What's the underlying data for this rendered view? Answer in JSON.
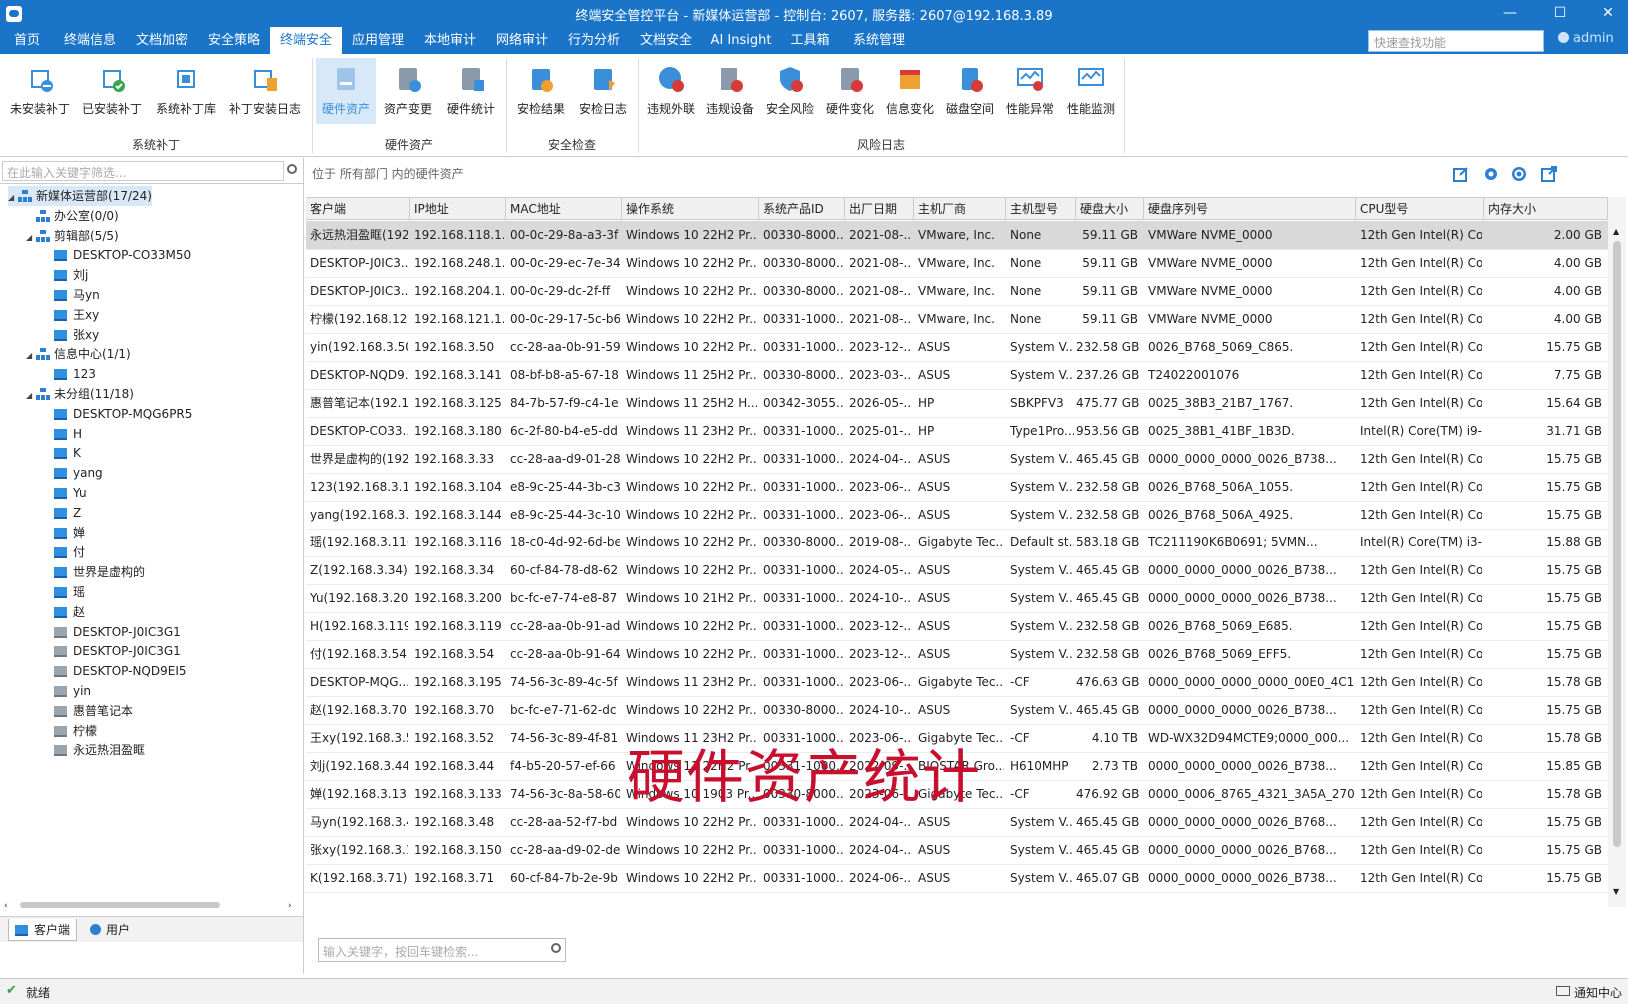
{
  "window": {
    "title": "终端安全管控平台 - 新媒体运营部 - 控制台: 2607, 服务器: 2607@192.168.3.89"
  },
  "menu": [
    "首页",
    "终端信息",
    "文档加密",
    "安全策略",
    "终端安全",
    "应用管理",
    "本地审计",
    "网络审计",
    "行为分析",
    "文档安全",
    "AI Insight",
    "工具箱",
    "系统管理"
  ],
  "quick_search": {
    "placeholder": "快速查找功能"
  },
  "user": {
    "name": "admin"
  },
  "ribbon": {
    "buttons": [
      "未安装补丁",
      "已安装补丁",
      "系统补丁库",
      "补丁安装日志",
      "硬件资产",
      "资产变更",
      "硬件统计",
      "安检结果",
      "安检日志",
      "违规外联",
      "违规设备",
      "安全风险",
      "硬件变化",
      "信息变化",
      "磁盘空间",
      "性能异常",
      "性能监测"
    ],
    "groups": [
      "系统补丁",
      "硬件资产",
      "安全检查",
      "风险日志"
    ]
  },
  "left": {
    "filter_placeholder": "在此输入关键字筛选...",
    "tree": [
      "新媒体运营部(17/24)",
      "办公室(0/0)",
      "剪辑部(5/5)",
      "DESKTOP-CO33M50",
      "刘j",
      "马yn",
      "王xy",
      "张xy",
      "信息中心(1/1)",
      "123",
      "未分组(11/18)",
      "DESKTOP-MQG6PR5",
      "H",
      "K",
      "yang",
      "Yu",
      "Z",
      "婵",
      "付",
      "世界是虚构的",
      "瑶",
      "赵",
      "DESKTOP-J0IC3G1",
      "DESKTOP-J0IC3G1",
      "DESKTOP-NQD9EI5",
      "yin",
      "惠普笔记本",
      "柠檬",
      "永远热泪盈眶"
    ],
    "tabs": [
      "客户端",
      "用户"
    ]
  },
  "main": {
    "breadcrumb": "位于 所有部门 内的硬件资产",
    "columns": [
      "客户端",
      "IP地址",
      "MAC地址",
      "操作系统",
      "系统产品ID",
      "出厂日期",
      "主机厂商",
      "主机型号",
      "硬盘大小",
      "硬盘序列号",
      "CPU型号",
      "内存大小"
    ],
    "rows": [
      [
        "永远热泪盈眶(192...",
        "192.168.118.1...",
        "00-0c-29-8a-a3-3f",
        "Windows 10 22H2 Pr...",
        "00330-8000...",
        "2021-08-...",
        "VMware, Inc.",
        "None",
        "59.11 GB",
        "VMWare NVME_0000",
        "12th Gen Intel(R) Co...",
        "2.00 GB"
      ],
      [
        "DESKTOP-J0IC3...",
        "192.168.248.1...",
        "00-0c-29-ec-7e-34",
        "Windows 10 22H2 Pr...",
        "00330-8000...",
        "2021-08-...",
        "VMware, Inc.",
        "None",
        "59.11 GB",
        "VMWare NVME_0000",
        "12th Gen Intel(R) Co...",
        "4.00 GB"
      ],
      [
        "DESKTOP-J0IC3...",
        "192.168.204.1...",
        "00-0c-29-dc-2f-ff",
        "Windows 10 22H2 Pr...",
        "00330-8000...",
        "2021-08-...",
        "VMware, Inc.",
        "None",
        "59.11 GB",
        "VMWare NVME_0000",
        "12th Gen Intel(R) Co...",
        "4.00 GB"
      ],
      [
        "柠檬(192.168.121...",
        "192.168.121.1...",
        "00-0c-29-17-5c-b6",
        "Windows 10 22H2 Pr...",
        "00331-1000...",
        "2021-08-...",
        "VMware, Inc.",
        "None",
        "59.11 GB",
        "VMWare NVME_0000",
        "12th Gen Intel(R) Co...",
        "4.00 GB"
      ],
      [
        "yin(192.168.3.50)",
        "192.168.3.50",
        "cc-28-aa-0b-91-59",
        "Windows 10 22H2 Pr...",
        "00331-1000...",
        "2023-12-...",
        "ASUS",
        "System V...",
        "232.58 GB",
        "0026_B768_5069_C865.",
        "12th Gen Intel(R) Co...",
        "15.75 GB"
      ],
      [
        "DESKTOP-NQD9...",
        "192.168.3.141",
        "08-bf-b8-a5-67-18",
        "Windows 11 25H2 Pr...",
        "00330-8000...",
        "2023-03-...",
        "ASUS",
        "System V...",
        "237.26 GB",
        "T24022001076",
        "12th Gen Intel(R) Co...",
        "7.75 GB"
      ],
      [
        "惠普笔记本(192.1...",
        "192.168.3.125",
        "84-7b-57-f9-c4-1e",
        "Windows 11 25H2 H...",
        "00342-3055...",
        "2026-05-...",
        "HP",
        "SBKPFV3",
        "475.77 GB",
        "0025_38B3_21B7_1767.",
        "12th Gen Intel(R) Co...",
        "15.64 GB"
      ],
      [
        "DESKTOP-CO33...",
        "192.168.3.180",
        "6c-2f-80-b4-e5-dd",
        "Windows 11 23H2 Pr...",
        "00331-1000...",
        "2025-01-...",
        "HP",
        "Type1Pro...",
        "953.56 GB",
        "0025_38B1_41BF_1B3D.",
        "Intel(R) Core(TM) i9-...",
        "31.71 GB"
      ],
      [
        "世界是虚构的(192...",
        "192.168.3.33",
        "cc-28-aa-d9-01-28",
        "Windows 10 22H2 Pr...",
        "00331-1000...",
        "2024-04-...",
        "ASUS",
        "System V...",
        "465.45 GB",
        "0000_0000_0000_0026_B738...",
        "12th Gen Intel(R) Co...",
        "15.75 GB"
      ],
      [
        "123(192.168.3.10...",
        "192.168.3.104",
        "e8-9c-25-44-3b-c3",
        "Windows 10 22H2 Pr...",
        "00331-1000...",
        "2023-06-...",
        "ASUS",
        "System V...",
        "232.58 GB",
        "0026_B768_506A_1055.",
        "12th Gen Intel(R) Co...",
        "15.75 GB"
      ],
      [
        "yang(192.168.3.1...",
        "192.168.3.144",
        "e8-9c-25-44-3c-10",
        "Windows 10 22H2 Pr...",
        "00331-1000...",
        "2023-06-...",
        "ASUS",
        "System V...",
        "232.58 GB",
        "0026_B768_506A_4925.",
        "12th Gen Intel(R) Co...",
        "15.75 GB"
      ],
      [
        "瑶(192.168.3.116)",
        "192.168.3.116",
        "18-c0-4d-92-6d-be",
        "Windows 10 22H2 Pr...",
        "00330-8000...",
        "2019-08-...",
        "Gigabyte Tec...",
        "Default st...",
        "583.18 GB",
        "TC211190K6B0691;        5VMN...",
        "Intel(R) Core(TM) i3-...",
        "15.88 GB"
      ],
      [
        "Z(192.168.3.34)",
        "192.168.3.34",
        "60-cf-84-78-d8-62",
        "Windows 10 22H2 Pr...",
        "00331-1000...",
        "2024-05-...",
        "ASUS",
        "System V...",
        "465.45 GB",
        "0000_0000_0000_0026_B738...",
        "12th Gen Intel(R) Co...",
        "15.75 GB"
      ],
      [
        "Yu(192.168.3.200)",
        "192.168.3.200",
        "bc-fc-e7-74-e8-87",
        "Windows 10 21H2 Pr...",
        "00331-1000...",
        "2024-10-...",
        "ASUS",
        "System V...",
        "465.45 GB",
        "0000_0000_0000_0026_B738...",
        "12th Gen Intel(R) Co...",
        "15.75 GB"
      ],
      [
        "H(192.168.3.119)",
        "192.168.3.119",
        "cc-28-aa-0b-91-ad",
        "Windows 10 22H2 Pr...",
        "00331-1000...",
        "2023-12-...",
        "ASUS",
        "System V...",
        "232.58 GB",
        "0026_B768_5069_E685.",
        "12th Gen Intel(R) Co...",
        "15.75 GB"
      ],
      [
        "付(192.168.3.54)",
        "192.168.3.54",
        "cc-28-aa-0b-91-64",
        "Windows 10 22H2 Pr...",
        "00331-1000...",
        "2023-12-...",
        "ASUS",
        "System V...",
        "232.58 GB",
        "0026_B768_5069_EFF5.",
        "12th Gen Intel(R) Co...",
        "15.75 GB"
      ],
      [
        "DESKTOP-MQG...",
        "192.168.3.195",
        "74-56-3c-89-4c-5f",
        "Windows 11 23H2 Pr...",
        "00331-1000...",
        "2023-06-...",
        "Gigabyte Tec...",
        "-CF",
        "476.63 GB",
        "0000_0000_0000_0000_00E0_4C11...",
        "12th Gen Intel(R) Co...",
        "15.78 GB"
      ],
      [
        "赵(192.168.3.70)",
        "192.168.3.70",
        "bc-fc-e7-71-62-dc",
        "Windows 10 22H2 Pr...",
        "00330-8000...",
        "2024-10-...",
        "ASUS",
        "System V...",
        "465.45 GB",
        "0000_0000_0000_0026_B738...",
        "12th Gen Intel(R) Co...",
        "15.75 GB"
      ],
      [
        "王xy(192.168.3.52)",
        "192.168.3.52",
        "74-56-3c-89-4f-81",
        "Windows 11 23H2 Pr...",
        "00331-1000...",
        "2023-06-...",
        "Gigabyte Tec...",
        "-CF",
        "4.10 TB",
        "WD-WX32D94MCTE9;0000_000...",
        "12th Gen Intel(R) Co...",
        "15.78 GB"
      ],
      [
        "刘j(192.168.3.44)",
        "192.168.3.44",
        "f4-b5-20-57-ef-66",
        "Windows 11 22H2 Pr...",
        "00331-1000...",
        "2022-09-...",
        "BIOSTAR Gro...",
        "H610MHP",
        "2.73 TB",
        "0000_0000_0000_0026_B738...",
        "12th Gen Intel(R) Co...",
        "15.85 GB"
      ],
      [
        "婵(192.168.3.133)",
        "192.168.3.133",
        "74-56-3c-8a-58-60",
        "Windows 10 1903 Pr...",
        "00330-8000...",
        "2023-06-...",
        "Gigabyte Tec...",
        "-CF",
        "476.92 GB",
        "0000_0006_8765_4321_3A5A_2702...",
        "12th Gen Intel(R) Co...",
        "15.78 GB"
      ],
      [
        "马yn(192.168.3.48)",
        "192.168.3.48",
        "cc-28-aa-52-f7-bd",
        "Windows 10 22H2 Pr...",
        "00331-1000...",
        "2024-04-...",
        "ASUS",
        "System V...",
        "465.45 GB",
        "0000_0000_0000_0026_B768...",
        "12th Gen Intel(R) Co...",
        "15.75 GB"
      ],
      [
        "张xy(192.168.3.1...",
        "192.168.3.150",
        "cc-28-aa-d9-02-de",
        "Windows 10 22H2 Pr...",
        "00331-1000...",
        "2024-04-...",
        "ASUS",
        "System V...",
        "465.45 GB",
        "0000_0000_0000_0026_B768...",
        "12th Gen Intel(R) Co...",
        "15.75 GB"
      ],
      [
        "K(192.168.3.71)",
        "192.168.3.71",
        "60-cf-84-7b-2e-9b",
        "Windows 10 22H2 Pr...",
        "00331-1000...",
        "2024-06-...",
        "ASUS",
        "System V...",
        "465.07 GB",
        "0000_0000_0000_0026_B738...",
        "12th Gen Intel(R) Co...",
        "15.75 GB"
      ]
    ],
    "search_placeholder": "输入关键字，按回车键检索..."
  },
  "overlay_text": "硬件资产统计",
  "status": {
    "left": "就绪",
    "right": "通知中心"
  },
  "colors": {
    "accent": "#1a74c8",
    "selected_row": "#d9d9d9",
    "overlay": "#c8102e"
  }
}
